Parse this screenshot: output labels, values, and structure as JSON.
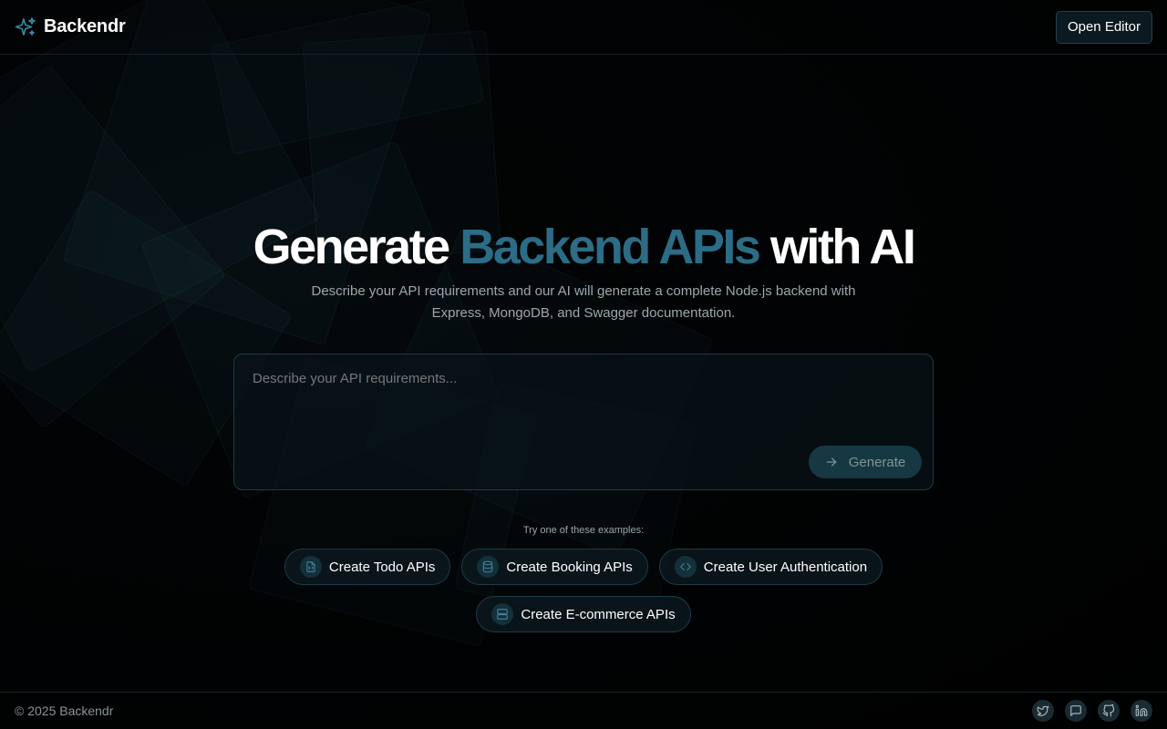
{
  "header": {
    "brand_name": "Backendr",
    "open_editor_label": "Open Editor"
  },
  "hero": {
    "title_part1": "Generate",
    "title_accent": "Backend APIs",
    "title_part2": "with AI",
    "subtitle": "Describe your API requirements and our AI will generate a complete Node.js backend with Express, MongoDB, and Swagger documentation."
  },
  "prompt": {
    "placeholder": "Describe your API requirements...",
    "value": "",
    "generate_label": "Generate"
  },
  "examples": {
    "label": "Try one of these examples:",
    "items": [
      {
        "label": "Create Todo APIs",
        "icon": "file-code-icon"
      },
      {
        "label": "Create Booking APIs",
        "icon": "database-icon"
      },
      {
        "label": "Create User Authentication",
        "icon": "code-icon"
      },
      {
        "label": "Create E-commerce APIs",
        "icon": "server-icon"
      }
    ]
  },
  "footer": {
    "copyright": "© 2025 Backendr",
    "socials": [
      "twitter-icon",
      "message-icon",
      "github-icon",
      "linkedin-icon"
    ]
  },
  "colors": {
    "accent": "#2c6c86",
    "background": "#020405",
    "border": "#1e3a45"
  }
}
